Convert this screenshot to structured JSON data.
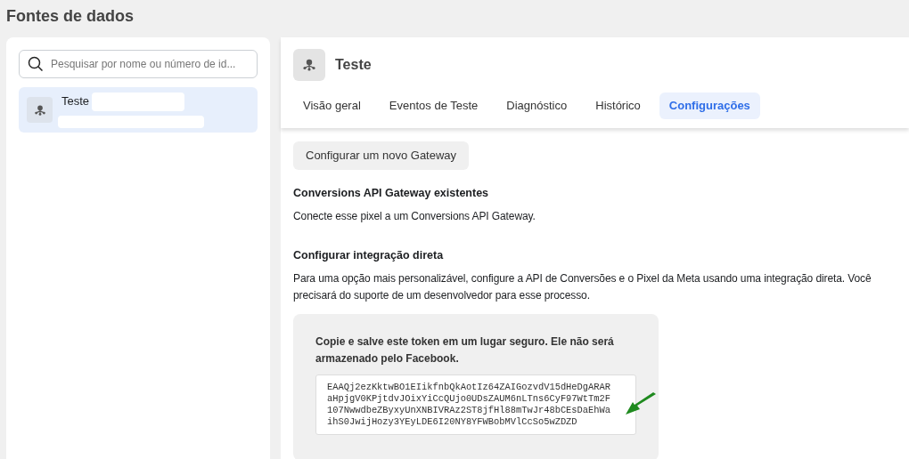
{
  "page_title": "Fontes de dados",
  "sidebar": {
    "search": {
      "placeholder": "Pesquisar por nome ou número de id..."
    },
    "items": [
      {
        "name": "Teste",
        "selected": true
      }
    ]
  },
  "header": {
    "title": "Teste"
  },
  "tabs": [
    {
      "label": "Visão geral",
      "selected": false
    },
    {
      "label": "Eventos de Teste",
      "selected": false
    },
    {
      "label": "Diagnóstico",
      "selected": false
    },
    {
      "label": "Histórico",
      "selected": false
    },
    {
      "label": "Configurações",
      "selected": true
    }
  ],
  "content": {
    "gateway_button": "Configurar um novo Gateway",
    "sections": [
      {
        "heading": "Conversions API Gateway existentes",
        "text": "Conecte esse pixel a um Conversions API Gateway."
      },
      {
        "heading": "Configurar integração direta",
        "text": "Para uma opção mais personalizável, configure a API de Conversões e o Pixel da Meta usando uma integração direta. Você precisará do suporte de um desenvolvedor para esse processo."
      }
    ],
    "token_card": {
      "notice": "Copie e salve este token em um lugar seguro. Ele não será armazenado pelo Facebook.",
      "token_lines": [
        "EAAQj2ezKktwBO1EIikfnbQkAotIz64ZAIGozvdV15dHeDgARAR",
        "aHpjgV0KPjtdvJOixYiCcQUjo0UDsZAUM6nLTns6CyF97WtTm2F",
        "107NwwdbeZByxyUnXNBIVRAz2ST8jfHl88mTwJr48bCEsDaEhWa",
        "ihS0JwijHozy3YEyLDE6I20NY8YFWBobMVlCcSo5wZDZD"
      ]
    }
  }
}
